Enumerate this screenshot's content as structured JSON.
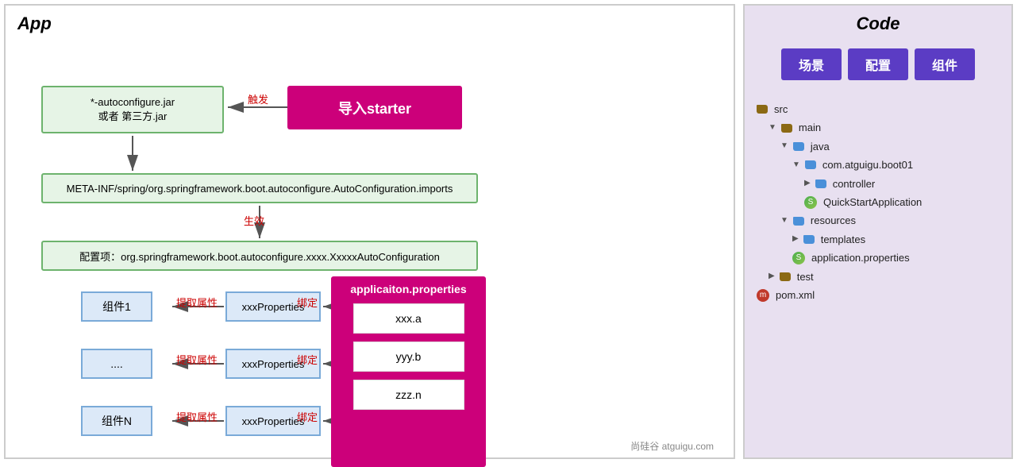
{
  "app": {
    "title": "App",
    "starter_box": "导入starter",
    "autoconfig_box_line1": "*-autoconfigure.jar",
    "autoconfig_box_line2": "或者 第三方.jar",
    "meta_box": "META-INF/spring/org.springframework.boot.autoconfigure.AutoConfiguration.imports",
    "config_item_box": "配置项：org.springframework.boot.autoconfigure.xxxx.XxxxxAutoConfiguration",
    "trigger_label": "触发",
    "effective_label": "生效",
    "appprops_title": "applicaiton.properties",
    "prop1": "xxx.a",
    "prop2": "yyy.b",
    "prop3": "zzz.n",
    "comp1": "组件1",
    "comp2": "....",
    "comp3": "组件N",
    "xxxprops": "xxxProperties",
    "fetch_label": "提取属性",
    "bind_label": "绑定"
  },
  "code": {
    "title": "Code",
    "btn1": "场景",
    "btn2": "配置",
    "btn3": "组件",
    "tree": [
      {
        "indent": 0,
        "icon": "folder",
        "label": "src"
      },
      {
        "indent": 1,
        "icon": "folder",
        "label": "main",
        "expanded": true
      },
      {
        "indent": 2,
        "icon": "folder-blue",
        "label": "java",
        "expanded": true
      },
      {
        "indent": 3,
        "icon": "folder-blue",
        "label": "com.atguigu.boot01",
        "expanded": true
      },
      {
        "indent": 4,
        "icon": "folder-blue",
        "label": "controller",
        "expanded": false
      },
      {
        "indent": 4,
        "icon": "spring",
        "label": "QuickStartApplication"
      },
      {
        "indent": 2,
        "icon": "folder-blue",
        "label": "resources",
        "expanded": true
      },
      {
        "indent": 3,
        "icon": "folder-blue",
        "label": "templates",
        "expanded": false
      },
      {
        "indent": 3,
        "icon": "spring",
        "label": "application.properties"
      },
      {
        "indent": 1,
        "icon": "folder",
        "label": "test",
        "expanded": false
      },
      {
        "indent": 0,
        "icon": "maven",
        "label": "pom.xml"
      }
    ]
  },
  "watermark": "尚硅谷 atguigu.com"
}
